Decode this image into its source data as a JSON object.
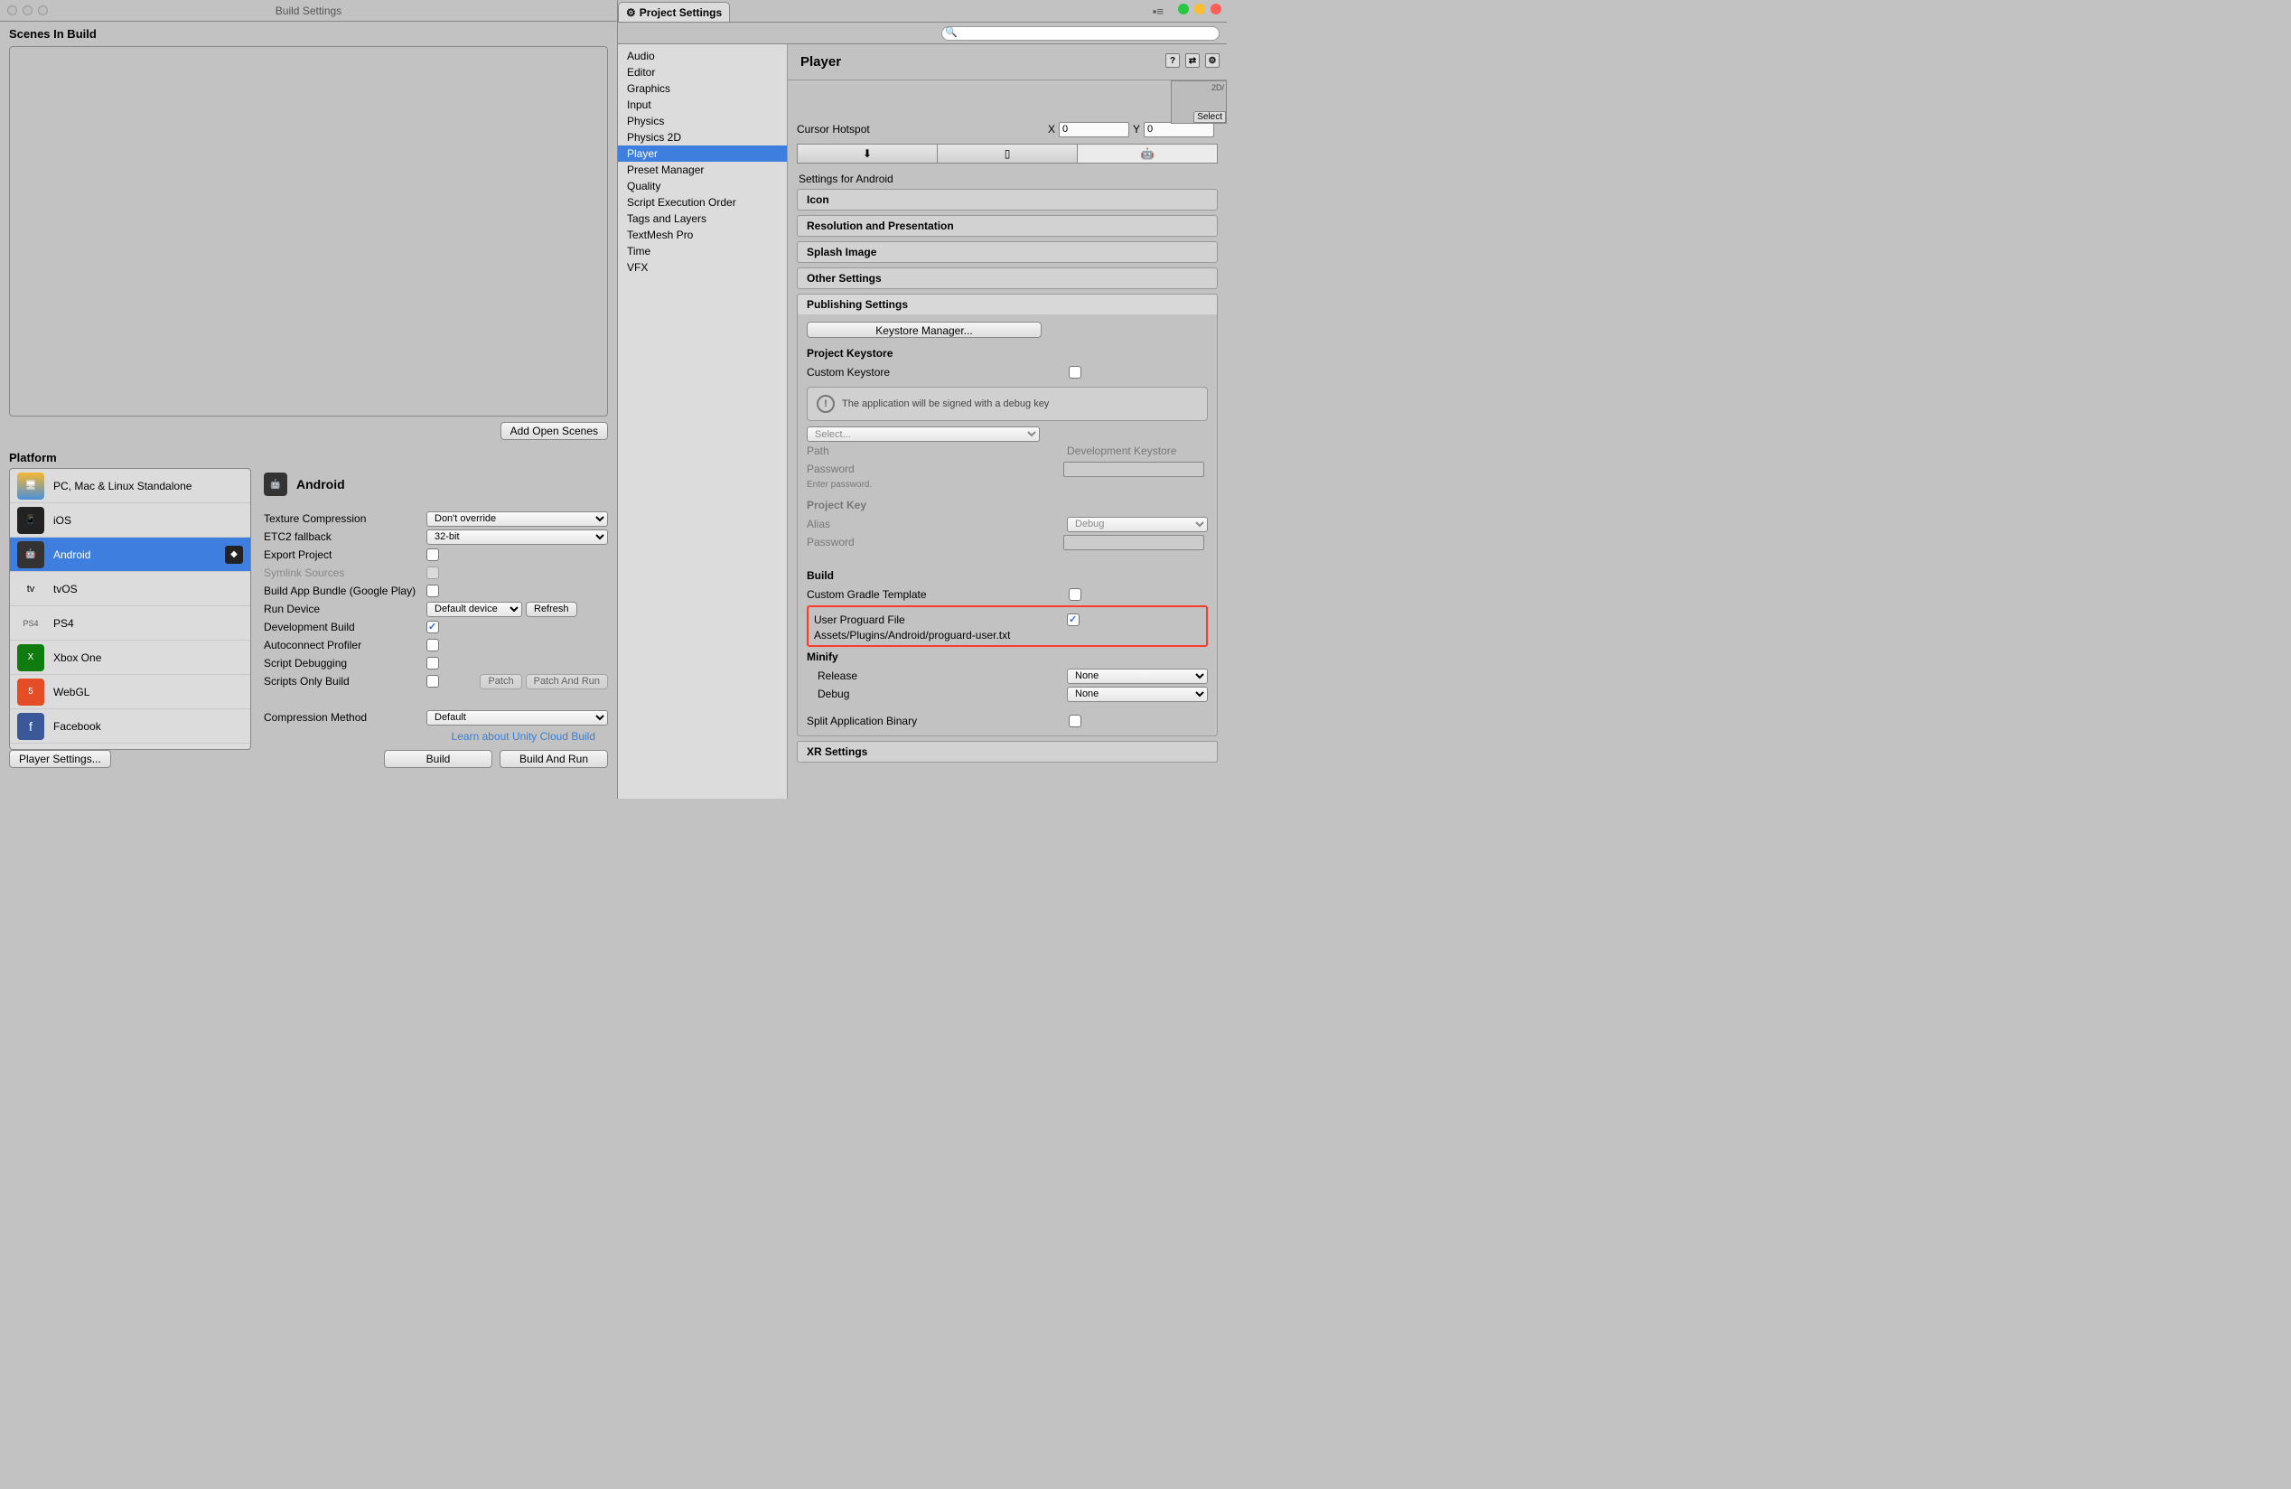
{
  "build": {
    "title": "Build Settings",
    "scenesLabel": "Scenes In Build",
    "addOpen": "Add Open Scenes",
    "platformLabel": "Platform",
    "platforms": [
      {
        "name": "PC, Mac & Linux Standalone"
      },
      {
        "name": "iOS"
      },
      {
        "name": "Android"
      },
      {
        "name": "tvOS"
      },
      {
        "name": "PS4"
      },
      {
        "name": "Xbox One"
      },
      {
        "name": "WebGL"
      },
      {
        "name": "Facebook"
      }
    ],
    "selectedPlatform": "Android",
    "options": {
      "textureCompression": {
        "label": "Texture Compression",
        "value": "Don't override"
      },
      "etc2": {
        "label": "ETC2 fallback",
        "value": "32-bit"
      },
      "export": {
        "label": "Export Project",
        "checked": false
      },
      "symlink": {
        "label": "Symlink Sources",
        "checked": false,
        "dim": true
      },
      "aab": {
        "label": "Build App Bundle (Google Play)",
        "checked": false
      },
      "runDevice": {
        "label": "Run Device",
        "value": "Default device",
        "refresh": "Refresh"
      },
      "devBuild": {
        "label": "Development Build",
        "checked": true
      },
      "autoconnect": {
        "label": "Autoconnect Profiler",
        "checked": false
      },
      "scriptDebug": {
        "label": "Script Debugging",
        "checked": false
      },
      "scriptsOnly": {
        "label": "Scripts Only Build",
        "checked": false,
        "patch": "Patch",
        "patchRun": "Patch And Run"
      },
      "compression": {
        "label": "Compression Method",
        "value": "Default"
      }
    },
    "cloudLink": "Learn about Unity Cloud Build",
    "playerSettingsBtn": "Player Settings...",
    "buildBtn": "Build",
    "buildRunBtn": "Build And Run"
  },
  "proj": {
    "tab": "Project Settings",
    "searchIcon": "🔍",
    "categories": [
      "Audio",
      "Editor",
      "Graphics",
      "Input",
      "Physics",
      "Physics 2D",
      "Player",
      "Preset Manager",
      "Quality",
      "Script Execution Order",
      "Tags and Layers",
      "TextMesh Pro",
      "Time",
      "VFX"
    ],
    "selected": "Player",
    "player": {
      "title": "Player",
      "thumb": {
        "hint": "2D/",
        "select": "Select"
      },
      "cursor": {
        "label": "Cursor Hotspot",
        "x": "0",
        "y": "0",
        "xl": "X",
        "yl": "Y"
      },
      "settingsFor": "Settings for Android",
      "folds": [
        "Icon",
        "Resolution and Presentation",
        "Splash Image",
        "Other Settings"
      ],
      "pub": {
        "title": "Publishing Settings",
        "keystoreMgr": "Keystore Manager...",
        "pkLabel": "Project Keystore",
        "customKeystore": "Custom Keystore",
        "info": "The application will be signed with a debug key",
        "select": "Select...",
        "path": "Path",
        "pathVal": "Development Keystore",
        "password": "Password",
        "pwHint": "Enter password.",
        "projKey": "Project Key",
        "alias": "Alias",
        "aliasVal": "Debug",
        "password2": "Password",
        "build": "Build",
        "cgt": "Custom Gradle Template",
        "upf": "User Proguard File",
        "upfPath": "Assets/Plugins/Android/proguard-user.txt",
        "minify": "Minify",
        "release": "Release",
        "releaseVal": "None",
        "debug": "Debug",
        "debugVal": "None",
        "split": "Split Application Binary"
      },
      "xr": "XR Settings"
    }
  }
}
